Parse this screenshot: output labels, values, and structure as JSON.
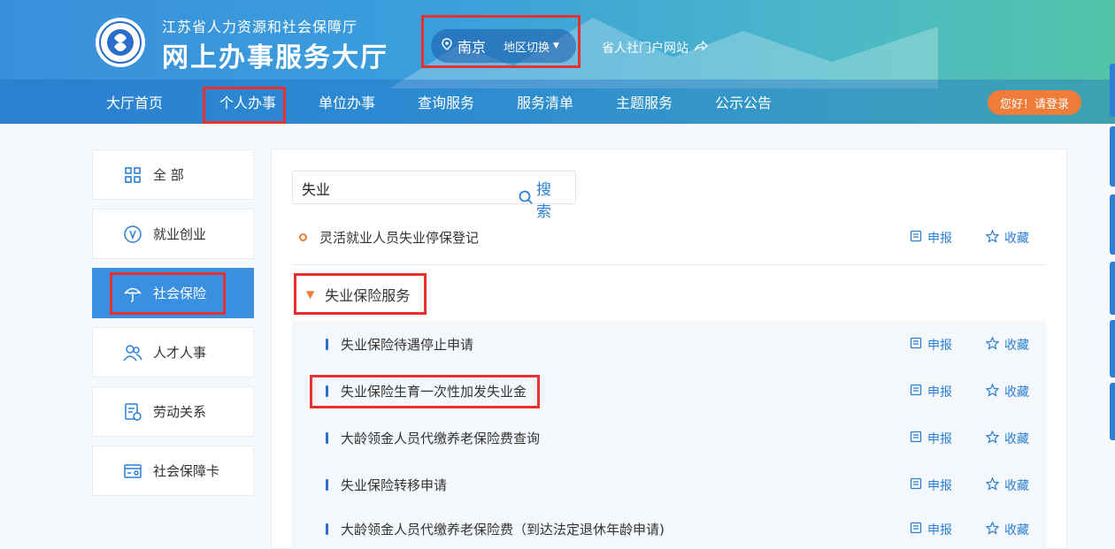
{
  "header": {
    "org_name": "江苏省人力资源和社会保障厅",
    "hall_name": "网上办事服务大厅",
    "region": {
      "city": "南京",
      "switch_label": "地区切换"
    },
    "portal_link": "省人社门户网站",
    "login_label": "您好！请登录"
  },
  "nav": {
    "items": [
      {
        "label": "大厅首页"
      },
      {
        "label": "个人办事"
      },
      {
        "label": "单位办事"
      },
      {
        "label": "查询服务"
      },
      {
        "label": "服务清单"
      },
      {
        "label": "主题服务"
      },
      {
        "label": "公示公告"
      }
    ],
    "active_index": 1
  },
  "sidebar": {
    "items": [
      {
        "label": "全 部",
        "icon": "grid-icon"
      },
      {
        "label": "就业创业",
        "icon": "employment-icon"
      },
      {
        "label": "社会保险",
        "icon": "umbrella-icon"
      },
      {
        "label": "人才人事",
        "icon": "people-icon"
      },
      {
        "label": "劳动关系",
        "icon": "document-icon"
      },
      {
        "label": "社会保障卡",
        "icon": "card-icon"
      }
    ],
    "active_index": 2
  },
  "search": {
    "value": "失业",
    "button_label": "搜索"
  },
  "results": {
    "top_item": "灵活就业人员失业停保登记",
    "group_title": "失业保险服务",
    "group_items": [
      "失业保险待遇停止申请",
      "失业保险生育一次性加发失业金",
      "大龄领金人员代缴养老保险费查询",
      "失业保险转移申请",
      "大龄领金人员代缴养老保险费（到达法定退休年龄申请)"
    ],
    "apply_label": "申报",
    "fav_label": "收藏"
  },
  "colors": {
    "accent": "#2a7fd6",
    "highlight": "#e8302f",
    "orange": "#f07c3a"
  }
}
